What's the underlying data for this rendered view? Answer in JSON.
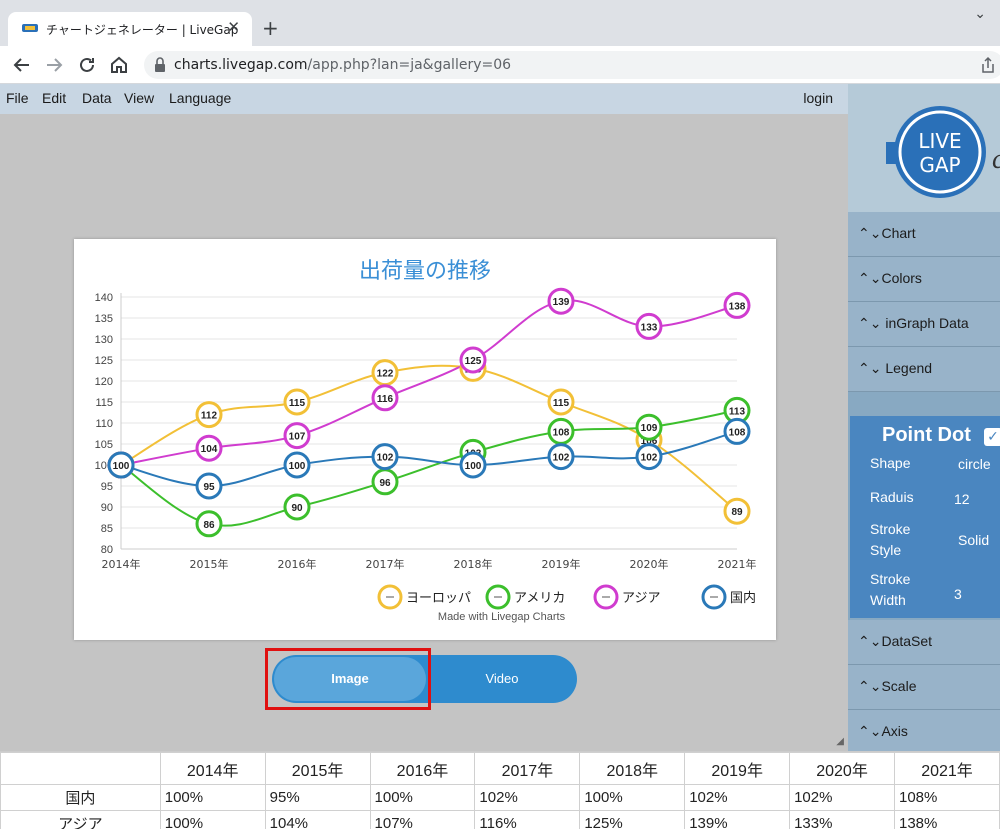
{
  "browser": {
    "tab_title": "チャートジェネレーター | LiveGap",
    "tab_close": "✕",
    "new_tab": "+",
    "window_chevron": "⌄",
    "url_host": "charts.livegap.com",
    "url_path": "/app.php?lan=ja&gallery=06",
    "nav_icons": [
      "back-arrow-icon",
      "forward-arrow-icon",
      "reload-icon",
      "home-icon"
    ]
  },
  "menubar": {
    "items": [
      "File",
      "Edit",
      "Data",
      "View",
      "Language"
    ],
    "login": "login"
  },
  "chart_data": {
    "type": "line",
    "title": "出荷量の推移",
    "categories": [
      "2014年",
      "2015年",
      "2016年",
      "2017年",
      "2018年",
      "2019年",
      "2020年",
      "2021年"
    ],
    "ylim": [
      80,
      140
    ],
    "yticks": [
      80,
      85,
      90,
      95,
      100,
      105,
      110,
      115,
      120,
      125,
      130,
      135,
      140
    ],
    "grid": true,
    "legend": "bottom-right",
    "series": [
      {
        "name": "ヨーロッパ",
        "color": "#f2c037",
        "values": [
          100,
          112,
          115,
          122,
          123,
          115,
          106,
          89
        ]
      },
      {
        "name": "アメリカ",
        "color": "#3cbf2c",
        "values": [
          100,
          86,
          90,
          96,
          103,
          108,
          109,
          113
        ]
      },
      {
        "name": "アジア",
        "color": "#d03ccf",
        "values": [
          100,
          104,
          107,
          116,
          125,
          139,
          133,
          138
        ]
      },
      {
        "name": "国内",
        "color": "#2a79b8",
        "values": [
          100,
          95,
          100,
          102,
          100,
          102,
          102,
          108
        ]
      }
    ]
  },
  "chart_credit": "Made with Livegap Charts",
  "export": {
    "image_label": "Image",
    "video_label": "Video"
  },
  "sidepanel": {
    "logo_text": "LIVE GAP",
    "sections_top": [
      {
        "label": "⌃⌄Chart"
      },
      {
        "label": "⌃⌄Colors"
      },
      {
        "label": "⌃⌄ inGraph Data"
      },
      {
        "label": "⌃⌄ Legend"
      }
    ],
    "pointdot": {
      "title": "Point Dot",
      "check": "✓",
      "props": [
        {
          "label": "Shape",
          "value": "circle"
        },
        {
          "label": "Raduis",
          "value": "12"
        },
        {
          "label": "Stroke\nStyle",
          "value": "Solid"
        },
        {
          "label": "Stroke\nWidth",
          "value": "3"
        }
      ]
    },
    "sections_bottom": [
      {
        "label": "⌃⌄DataSet"
      },
      {
        "label": "⌃⌄Scale"
      },
      {
        "label": "⌃⌄Axis"
      }
    ]
  },
  "table": {
    "headers": [
      "",
      "2014年",
      "2015年",
      "2016年",
      "2017年",
      "2018年",
      "2019年",
      "2020年",
      "2021年"
    ],
    "rows": [
      {
        "name": "国内",
        "cells": [
          "100%",
          "95%",
          "100%",
          "102%",
          "100%",
          "102%",
          "102%",
          "108%"
        ]
      },
      {
        "name": "アジア",
        "cells": [
          "100%",
          "104%",
          "107%",
          "116%",
          "125%",
          "139%",
          "133%",
          "138%"
        ]
      }
    ]
  }
}
